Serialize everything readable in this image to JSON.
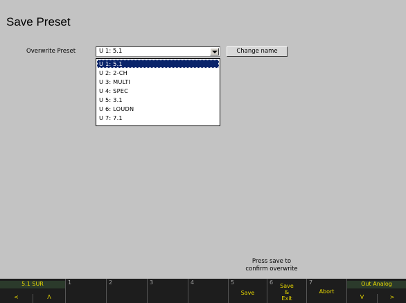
{
  "window": {
    "title": "Save Preset"
  },
  "form": {
    "overwrite_label": "Overwrite Preset",
    "combo_value": "U 1: 5.1",
    "change_name_label": "Change name"
  },
  "dropdown": {
    "options": [
      "U 1: 5.1",
      "U 2: 2-CH",
      "U 3: MULTI",
      "U 4: SPEC",
      "U 5: 3.1",
      "U 6: LOUDN",
      "U 7: 7.1"
    ],
    "selected": "U 1: 5.1"
  },
  "hint": {
    "line1": "Press save to",
    "line2": "confirm overwrite"
  },
  "softkeys": {
    "k0": {
      "top": "5.1 SUR",
      "left": "<",
      "right": "Λ"
    },
    "k1": {
      "num": "1"
    },
    "k2": {
      "num": "2"
    },
    "k3": {
      "num": "3"
    },
    "k4": {
      "num": "4"
    },
    "k5": {
      "num": "5",
      "label": "Save"
    },
    "k6": {
      "num": "6",
      "l1": "Save",
      "l2": "&",
      "l3": "Exit"
    },
    "k7": {
      "num": "7",
      "label": "Abort"
    },
    "k8": {
      "top": "Out Analog",
      "left": "V",
      "right": ">"
    }
  },
  "colors": {
    "background": "#c3c3c3",
    "softbar": "#1d1d1d",
    "softkey_text": "#e8d800",
    "selection": "#0a246a"
  }
}
